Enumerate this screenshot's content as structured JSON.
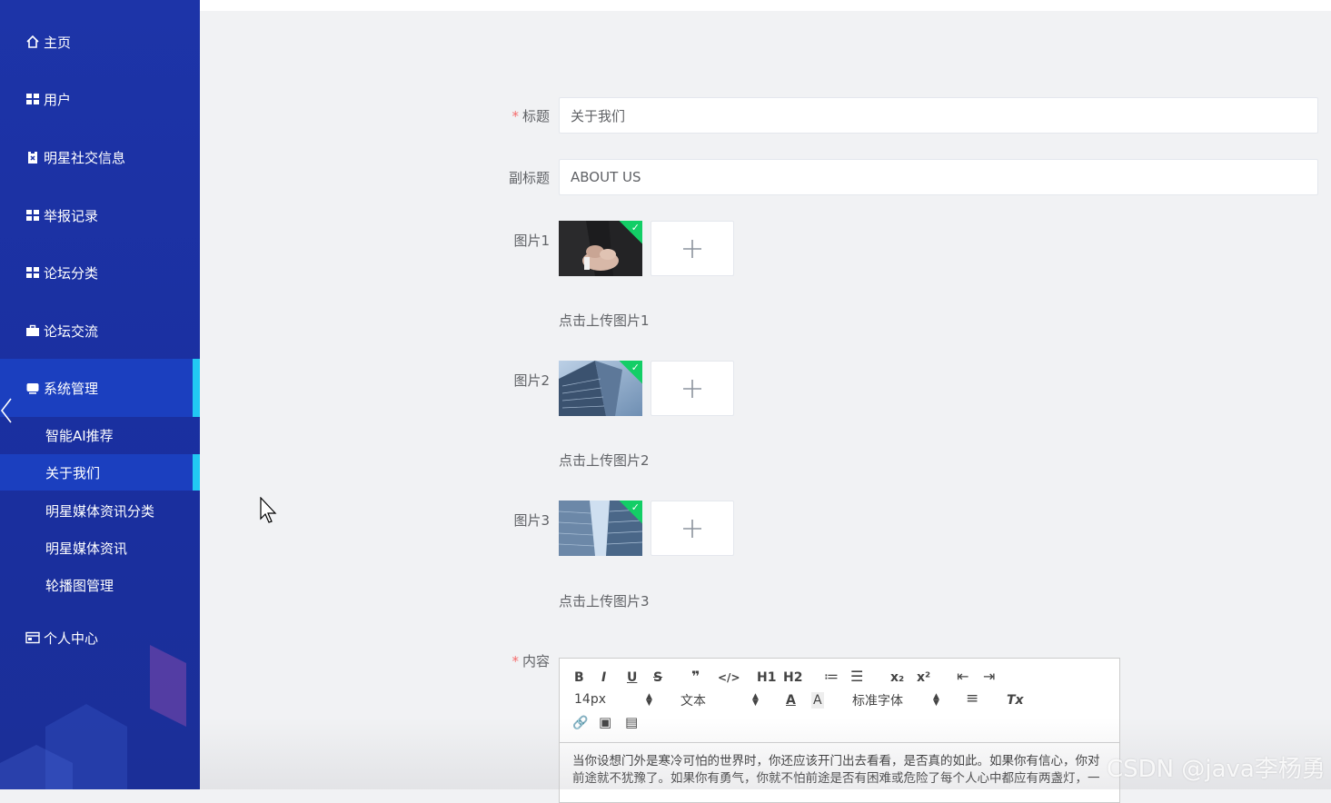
{
  "sidebar": {
    "items": [
      {
        "label": "主页",
        "icon": "home-icon"
      },
      {
        "label": "用户",
        "icon": "grid-icon"
      },
      {
        "label": "明星社交信息",
        "icon": "clipboard-icon"
      },
      {
        "label": "举报记录",
        "icon": "grid-icon"
      },
      {
        "label": "论坛分类",
        "icon": "grid-icon"
      },
      {
        "label": "论坛交流",
        "icon": "briefcase-icon"
      },
      {
        "label": "系统管理",
        "icon": "monitor-icon"
      },
      {
        "label": "个人中心",
        "icon": "id-card-icon"
      }
    ],
    "submenu": [
      {
        "label": "智能AI推荐"
      },
      {
        "label": "关于我们"
      },
      {
        "label": "明星媒体资讯分类"
      },
      {
        "label": "明星媒体资讯"
      },
      {
        "label": "轮播图管理"
      }
    ]
  },
  "form": {
    "title_label": "标题",
    "title_value": "关于我们",
    "subtitle_label": "副标题",
    "subtitle_value": "ABOUT US",
    "required_mark": "*",
    "images": [
      {
        "label": "图片1",
        "tip": "点击上传图片1"
      },
      {
        "label": "图片2",
        "tip": "点击上传图片2"
      },
      {
        "label": "图片3",
        "tip": "点击上传图片3"
      }
    ],
    "plus": "+",
    "check": "✓",
    "content_label": "内容"
  },
  "editor": {
    "buttons": {
      "bold": "B",
      "italic": "I",
      "underline": "U",
      "strike": "S",
      "quote": "❞",
      "code": "</>",
      "h1": "H1",
      "h2": "H2",
      "ordered_list": "≔",
      "bullet_list": "☰",
      "sub": "x₂",
      "sup": "x²",
      "outdent": "⇤",
      "indent": "⇥",
      "font_color": "A",
      "bg_color": "A",
      "align": "≡",
      "clean": "Tx",
      "link": "🔗",
      "image": "▣",
      "video": "▤"
    },
    "size": "14px",
    "header": "文本",
    "font": "标准字体",
    "content_line1": "当你设想门外是寒冷可怕的世界时，你还应该开门出去看看，是否真的如此。如果你有信心，你对",
    "content_line2": "前途就不犹豫了。如果你有勇气，你就不怕前途是否有困难或危险了每个人心中都应有两盏灯，一"
  },
  "watermark": "CSDN @java李杨勇",
  "colors": {
    "sidebar": "#1d34a8",
    "active": "#1b3fbf",
    "indicator": "#21c9f3",
    "required": "#f56c6c",
    "badge": "#13ce66"
  }
}
